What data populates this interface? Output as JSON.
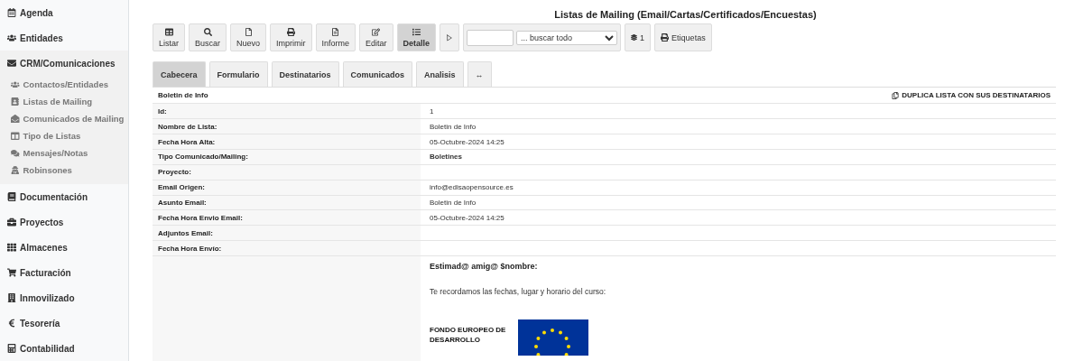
{
  "sidebar": {
    "items": [
      {
        "label": "Agenda",
        "expanded": false
      },
      {
        "label": "Entidades",
        "expanded": false
      },
      {
        "label": "CRM/Comunicaciones",
        "expanded": true,
        "children": [
          {
            "label": "Contactos/Entidades"
          },
          {
            "label": "Listas de Mailing"
          },
          {
            "label": "Comunicados de Mailing"
          },
          {
            "label": "Tipo de Listas"
          },
          {
            "label": "Mensajes/Notas"
          },
          {
            "label": "Robinsones"
          }
        ]
      },
      {
        "label": "Documentación",
        "expanded": false
      },
      {
        "label": "Proyectos",
        "expanded": false
      },
      {
        "label": "Almacenes",
        "expanded": false
      },
      {
        "label": "Facturación",
        "expanded": false
      },
      {
        "label": "Inmovilizado",
        "expanded": false
      },
      {
        "label": "Tesorería",
        "expanded": false
      },
      {
        "label": "Contabilidad",
        "expanded": false
      }
    ]
  },
  "page_title": "Listas de Mailing (Email/Cartas/Certificados/Encuestas)",
  "toolbar": {
    "buttons": [
      {
        "label": "Listar",
        "selected": false
      },
      {
        "label": "Buscar",
        "selected": false
      },
      {
        "label": "Nuevo",
        "selected": false
      },
      {
        "label": "Imprimir",
        "selected": false
      },
      {
        "label": "Informe",
        "selected": false
      },
      {
        "label": "Editar",
        "selected": false
      },
      {
        "label": "Detalle",
        "selected": true
      }
    ],
    "search_select": "... buscar todo",
    "count": "1",
    "labels_button": "Etiquetas"
  },
  "tabs": [
    {
      "label": "Cabecera",
      "selected": true
    },
    {
      "label": "Formulario",
      "selected": false
    },
    {
      "label": "Destinatarios",
      "selected": false
    },
    {
      "label": "Comunicados",
      "selected": false
    },
    {
      "label": "Analisis",
      "selected": false
    },
    {
      "label": "↔",
      "selected": false
    }
  ],
  "record": {
    "title": "Boletin de Info",
    "action": "DUPLICA LISTA CON SUS DESTINATARIOS",
    "rows": [
      {
        "label": "Id:",
        "value": "1",
        "bold": false
      },
      {
        "label": "Nombre de Lista:",
        "value": "Boletin de Info",
        "bold": false
      },
      {
        "label": "Fecha Hora Alta:",
        "value": "05-Octubre-2024  14:25",
        "bold": false
      },
      {
        "label": "Tipo Comunicado/Mailing:",
        "value": "Boletines",
        "bold": true
      },
      {
        "label": "Proyecto:"
      },
      {
        "label": "Email Origen:",
        "value": "info@edisaopensource.es",
        "bold": false
      },
      {
        "label": "Asunto Email:",
        "value": "Boletin de Info",
        "bold": false
      },
      {
        "label": "Fecha Hora Envio Email:",
        "value": "05-Octubre-2024  14:25",
        "bold": false
      },
      {
        "label": "Adjuntos Email:"
      },
      {
        "label": "Fecha Hora Envío:"
      }
    ],
    "body": {
      "greeting": "Estimad@ amig@ $nombre:",
      "paragraph": "Te recordamos las fechas, lugar y horario del curso:",
      "fund_text": "FONDO EUROPEO DE DESARROLLO"
    }
  }
}
